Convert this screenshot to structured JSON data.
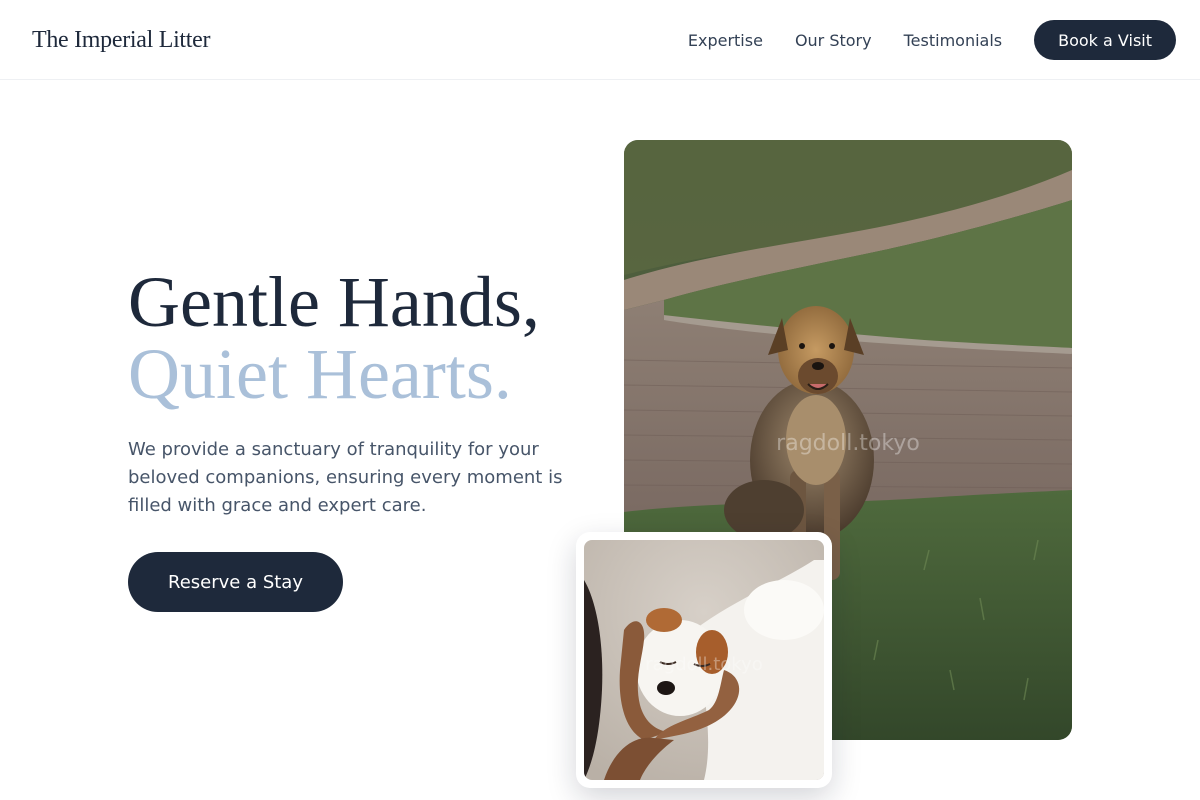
{
  "header": {
    "brand": "The Imperial Litter",
    "nav": [
      {
        "label": "Expertise"
      },
      {
        "label": "Our Story"
      },
      {
        "label": "Testimonials"
      }
    ],
    "cta_label": "Book a Visit"
  },
  "hero": {
    "title_line1": "Gentle Hands,",
    "title_line2": "Quiet Hearts.",
    "description": "We provide a sanctuary of tranquility for your beloved companions, ensuring every moment is filled with grace and expert care.",
    "cta_label": "Reserve a Stay"
  },
  "images": {
    "main_watermark": "ragdoll.tokyo",
    "inset_watermark": "ragdoll.tokyo"
  },
  "colors": {
    "navy": "#1e293b",
    "accent_blue": "#aac0d9",
    "body_text": "#475569"
  }
}
